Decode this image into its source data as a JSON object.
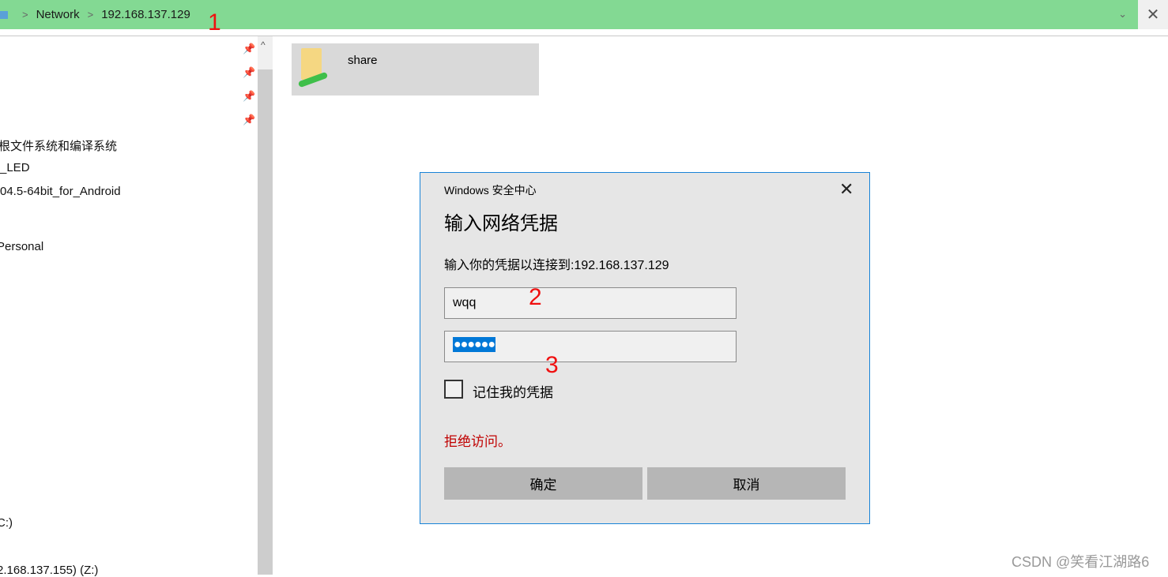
{
  "address_bar": {
    "icon": "computer-icon",
    "crumbs": [
      "Network",
      "192.168.137.129"
    ],
    "dropdown_icon": "chevron-down-icon"
  },
  "annotations": [
    "1",
    "2",
    "3"
  ],
  "sidebar": {
    "pins": 4,
    "items": [
      "根文件系统和编译系统",
      "_LED",
      "04.5-64bit_for_Android",
      "Personal",
      "C:)",
      "2.168.137.155) (Z:)"
    ]
  },
  "main": {
    "items": [
      {
        "label": "share",
        "icon": "network-share-folder-icon"
      }
    ]
  },
  "dialog": {
    "app_title": "Windows 安全中心",
    "title": "输入网络凭据",
    "message": "输入你的凭据以连接到:192.168.137.129",
    "username": "wqq",
    "password": "●●●●●●",
    "remember_label": "记住我的凭据",
    "remember_checked": false,
    "error": "拒绝访问。",
    "ok_label": "确定",
    "cancel_label": "取消",
    "accent": "#1883d7",
    "error_color": "#c00000"
  },
  "watermark": "CSDN @笑看江湖路6"
}
